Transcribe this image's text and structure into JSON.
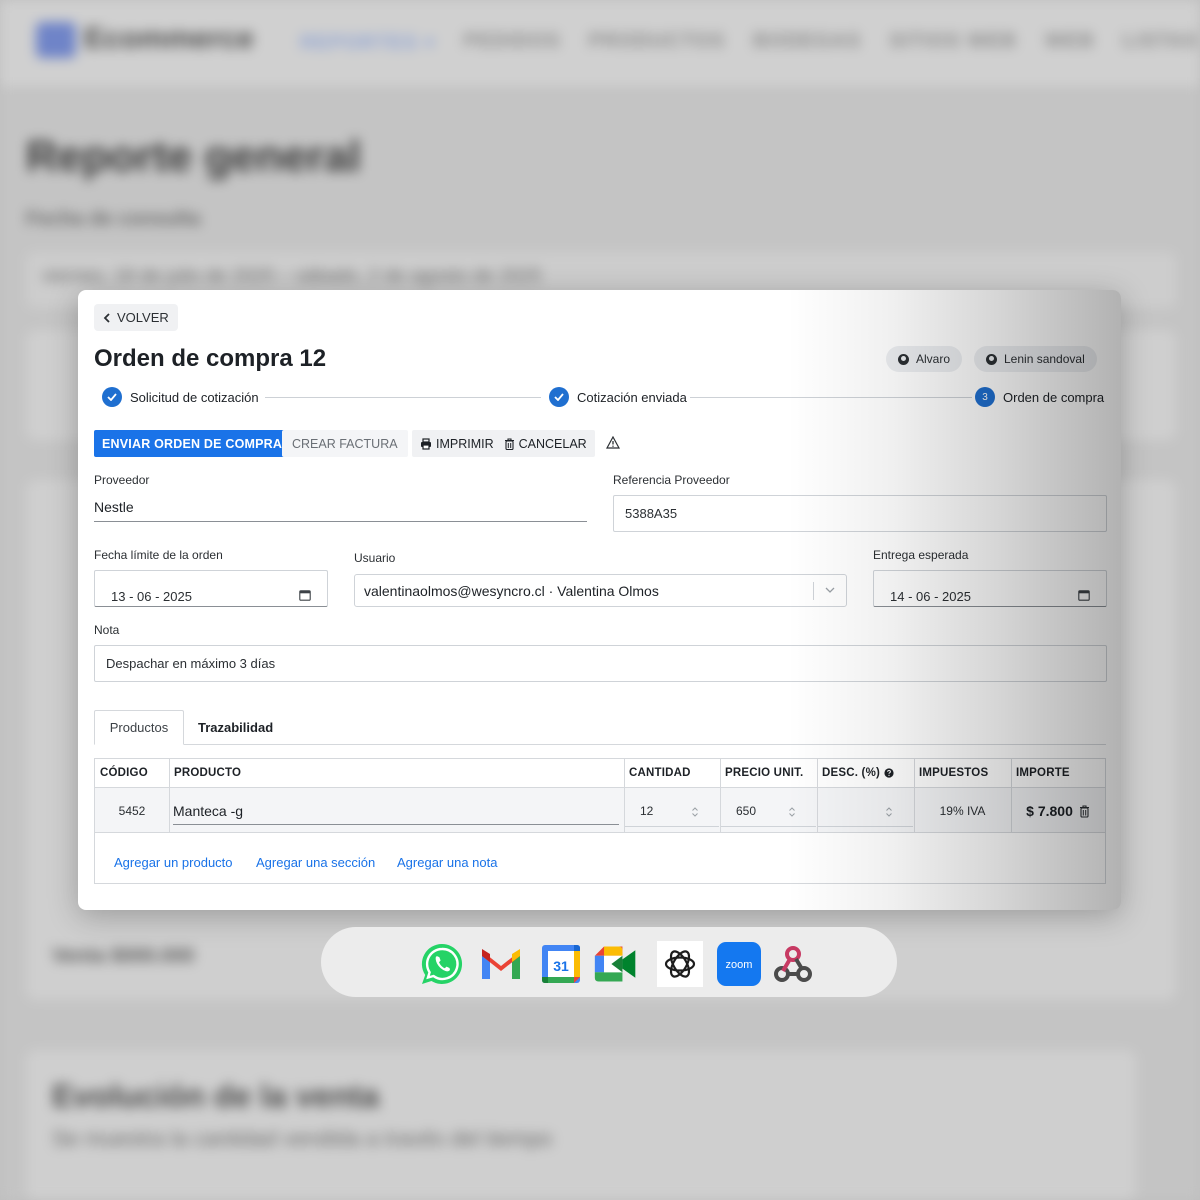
{
  "modal": {
    "back_label": "VOLVER",
    "title": "Orden de compra 12",
    "users": [
      "Alvaro",
      "Lenin sandoval"
    ],
    "steps": [
      {
        "label": "Solicitud de cotización",
        "state": "done"
      },
      {
        "label": "Cotización enviada",
        "state": "done"
      },
      {
        "label": "Orden de compra",
        "state": "current",
        "number": "3"
      }
    ],
    "toolbar": {
      "send": "ENVIAR ORDEN DE COMPRA",
      "invoice": "CREAR FACTURA",
      "print": "IMPRIMIR",
      "cancel": "CANCELAR"
    },
    "form": {
      "supplier_label": "Proveedor",
      "supplier_value": "Nestle",
      "supplier_ref_label": "Referencia Proveedor",
      "supplier_ref_value": "5388A35",
      "deadline_label": "Fecha límite de la orden",
      "deadline_value": "13 - 06 - 2025",
      "user_label": "Usuario",
      "user_value": "valentinaolmos@wesyncro.cl · Valentina Olmos",
      "delivery_label": "Entrega esperada",
      "delivery_value": "14 - 06 - 2025",
      "note_label": "Nota",
      "note_value": "Despachar en máximo 3 días"
    },
    "tabs": [
      "Productos",
      "Trazabilidad"
    ],
    "table": {
      "headers": [
        "CÓDIGO",
        "PRODUCTO",
        "CANTIDAD",
        "PRECIO UNIT.",
        "DESC. (%)",
        "IMPUESTOS",
        "IMPORTE"
      ],
      "rows": [
        {
          "code": "5452",
          "product": "Manteca -g",
          "qty": "12",
          "price": "650",
          "discount": "",
          "tax": "19% IVA",
          "amount": "$ 7.800"
        }
      ],
      "links": [
        "Agregar un producto",
        "Agregar una sección",
        "Agregar una nota"
      ]
    }
  },
  "background": {
    "logo": "Ecommerce",
    "nav": [
      "REPORTES ▾",
      "PEDIDOS",
      "PRODUCTOS",
      "BODEGAS",
      "SITIOS WEB",
      "WEB",
      "LISTAS"
    ],
    "title": "Reporte general",
    "subtitle": "Fecha de consulta",
    "range": "viernes, 18 de julio de 2025 – sábado, 2 de agosto de 2025",
    "section_title": "Evolución de la venta",
    "section_sub": "Se muestra la cantidad vendida a través del tiempo",
    "total": "Venta $000.000"
  },
  "dock": {
    "apps": [
      "whatsapp-icon",
      "gmail-icon",
      "google-calendar-icon",
      "google-meet-icon",
      "openai-icon",
      "zoom-icon",
      "webhook-icon"
    ],
    "calendar_day": "31",
    "zoom_label": "zoom"
  },
  "colors": {
    "primary": "#1a73e8",
    "step": "#1f6fd0"
  }
}
